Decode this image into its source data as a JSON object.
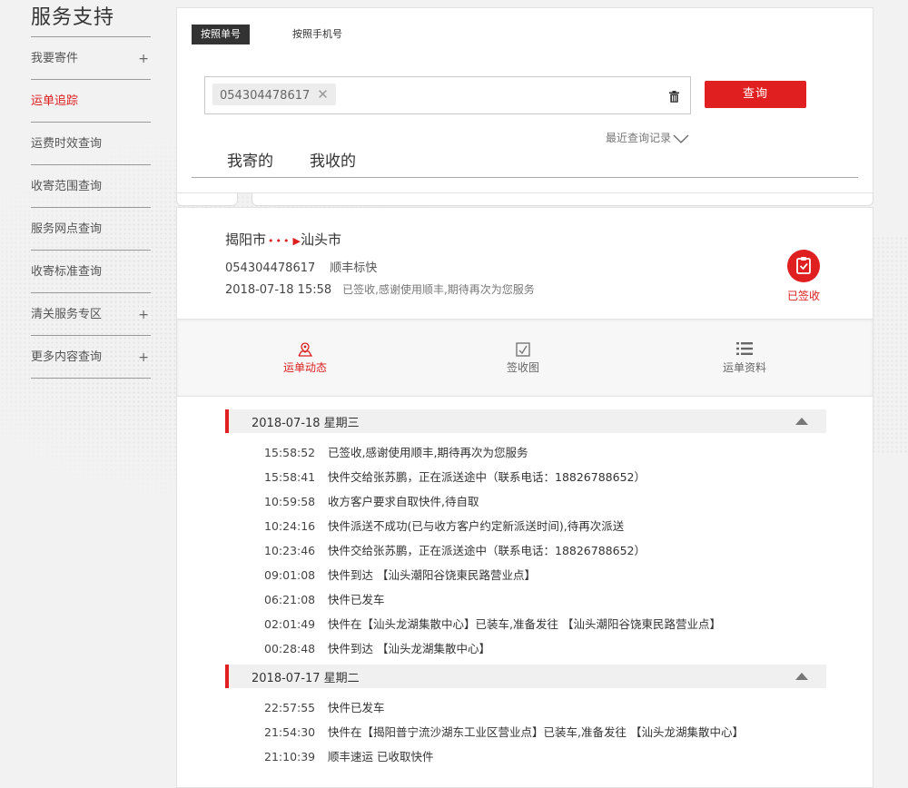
{
  "sidebar": {
    "title": "服务支持",
    "items": [
      {
        "label": "我要寄件",
        "plus": "+"
      },
      {
        "label": "运单追踪",
        "plus": ""
      },
      {
        "label": "运费时效查询",
        "plus": ""
      },
      {
        "label": "收寄范围查询",
        "plus": ""
      },
      {
        "label": "服务网点查询",
        "plus": ""
      },
      {
        "label": "收寄标准查询",
        "plus": ""
      },
      {
        "label": "清关服务专区",
        "plus": "+"
      },
      {
        "label": "更多内容查询",
        "plus": "+"
      }
    ]
  },
  "search": {
    "tab_by_waybill": "按照单号",
    "tab_by_phone": "按照手机号",
    "chip_value": "054304478617",
    "query_button": "查询",
    "recent_records": "最近查询记录",
    "tab_sent": "我寄的",
    "tab_received": "我收的"
  },
  "result": {
    "origin": "揭阳市",
    "destination": "汕头市",
    "waybill": "054304478617",
    "service": "顺丰标快",
    "datetime": "2018-07-18 15:58",
    "status_text": "已签收,感谢使用顺丰,期待再次为您服务",
    "badge": "已签收"
  },
  "actions": {
    "tracking": "运单动态",
    "signature": "签收图",
    "details": "运单资料"
  },
  "timeline": [
    {
      "date": "2018-07-18 星期三",
      "events": [
        {
          "time": "15:58:52",
          "desc": "已签收,感谢使用顺丰,期待再次为您服务"
        },
        {
          "time": "15:58:41",
          "desc": "快件交给张苏鹏，正在派送途中（联系电话：18826788652）"
        },
        {
          "time": "10:59:58",
          "desc": "收方客户要求自取快件,待自取"
        },
        {
          "time": "10:24:16",
          "desc": "快件派送不成功(已与收方客户约定新派送时间),待再次派送"
        },
        {
          "time": "10:23:46",
          "desc": "快件交给张苏鹏，正在派送途中（联系电话：18826788652）"
        },
        {
          "time": "09:01:08",
          "desc": "快件到达 【汕头潮阳谷饶東民路营业点】"
        },
        {
          "time": "06:21:08",
          "desc": "快件已发车"
        },
        {
          "time": "02:01:49",
          "desc": "快件在【汕头龙湖集散中心】已装车,准备发往 【汕头潮阳谷饶東民路营业点】"
        },
        {
          "time": "00:28:48",
          "desc": "快件到达 【汕头龙湖集散中心】"
        }
      ]
    },
    {
      "date": "2018-07-17 星期二",
      "events": [
        {
          "time": "22:57:55",
          "desc": "快件已发车"
        },
        {
          "time": "21:54:30",
          "desc": "快件在【揭阳普宁流沙湖东工业区营业点】已装车,准备发往 【汕头龙湖集散中心】"
        },
        {
          "time": "21:10:39",
          "desc": "顺丰速运 已收取快件"
        }
      ]
    }
  ],
  "colors": {
    "accent": "#e02020",
    "dark_tab": "#333333"
  }
}
